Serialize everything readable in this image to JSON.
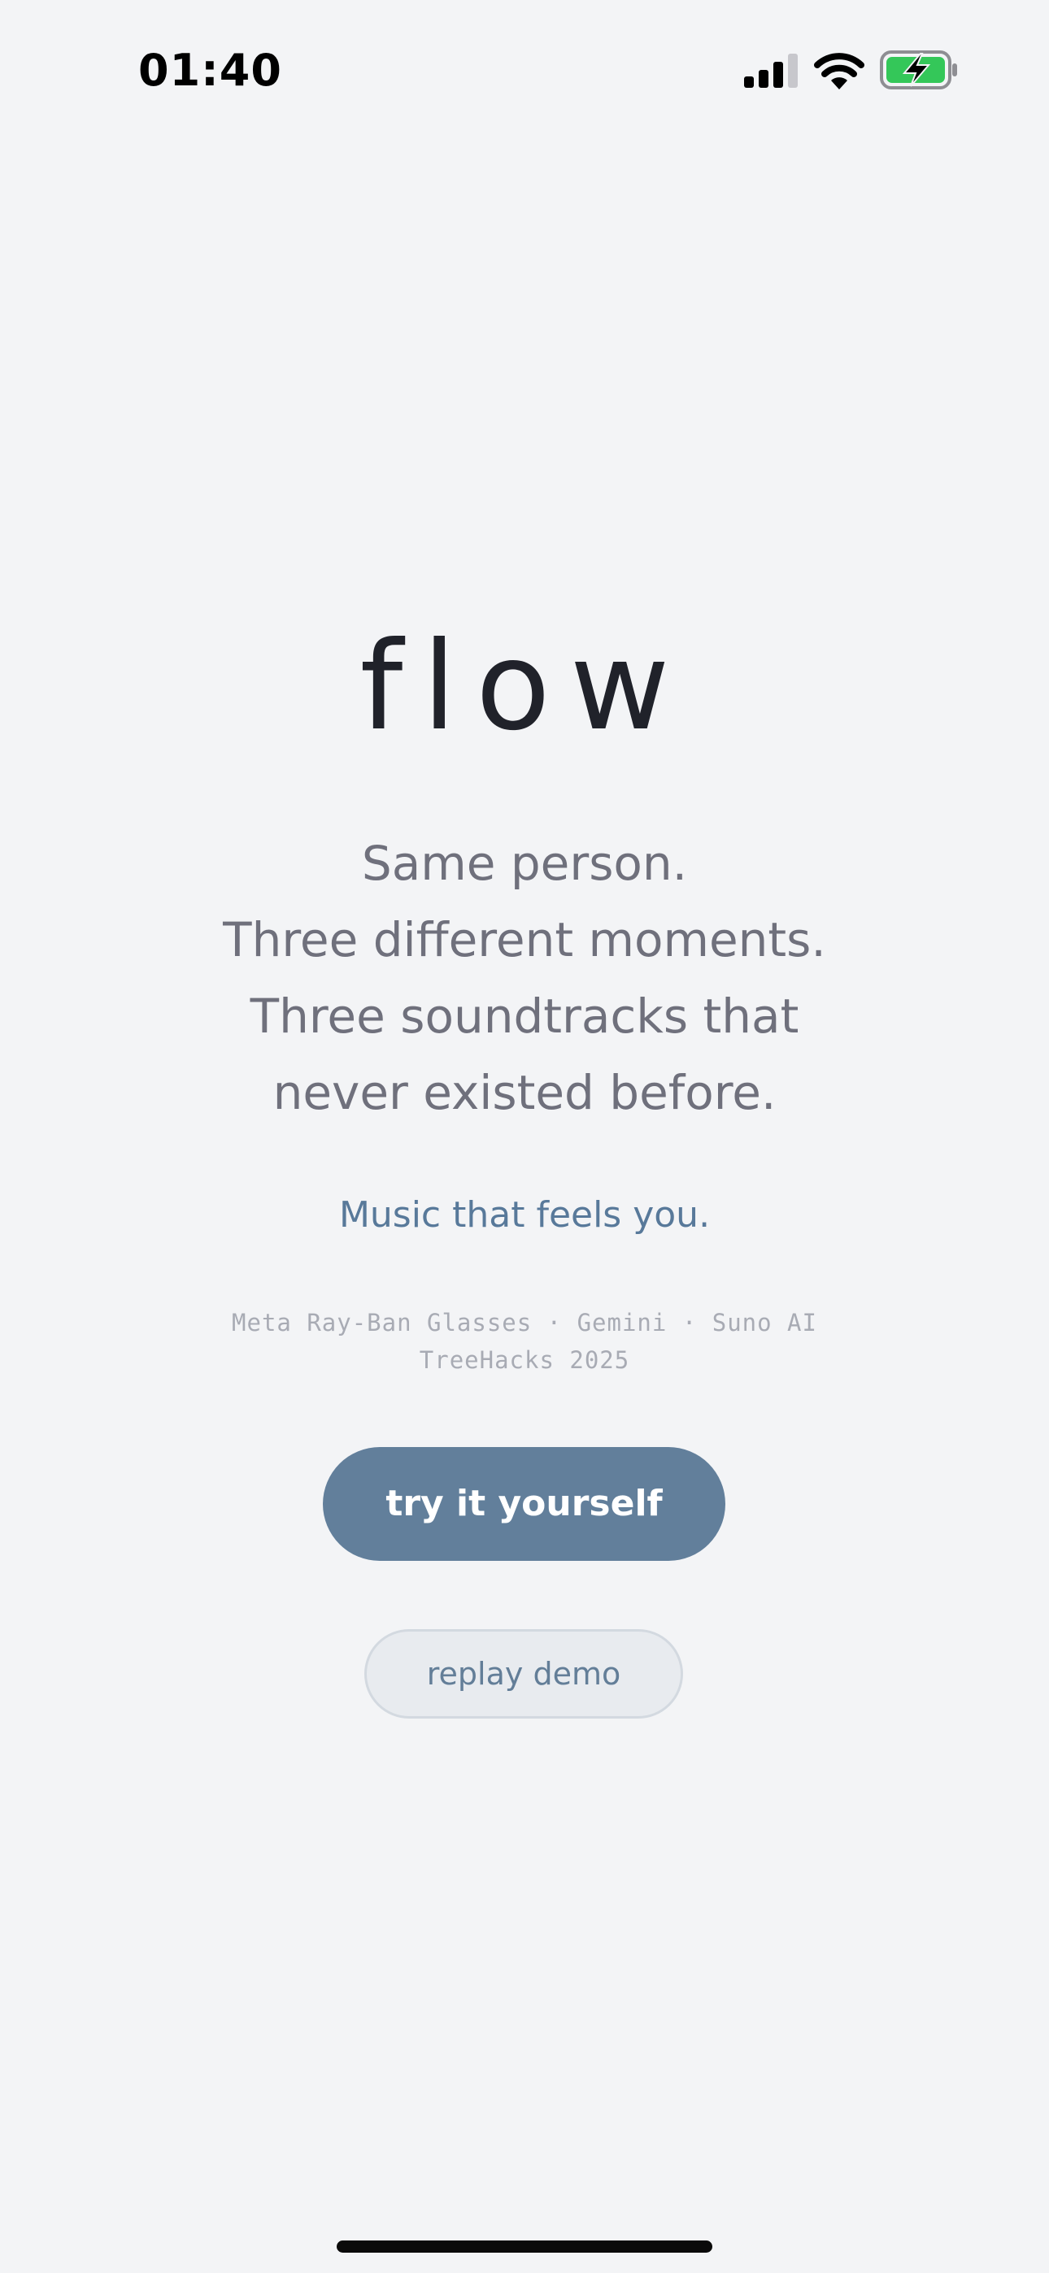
{
  "status_bar": {
    "time": "01:40",
    "icons": [
      "signal-icon",
      "wifi-icon",
      "battery-charging-icon"
    ],
    "battery_color": "#34c759"
  },
  "main": {
    "title": "flow",
    "tagline": [
      "Same person.",
      "Three different moments.",
      "Three soundtracks that",
      "never existed before."
    ],
    "subtitle": "Music that feels you.",
    "credits": {
      "line1": "Meta Ray-Ban Glasses · Gemini · Suno AI",
      "line2": "TreeHacks 2025"
    },
    "primary_button": "try it yourself",
    "secondary_button": "replay demo"
  },
  "colors": {
    "background": "#f3f4f6",
    "title": "#20222a",
    "tagline": "#6f707c",
    "accent": "#58799a",
    "primary_button_bg": "#627f9b",
    "secondary_button_bg": "#e8ebef"
  }
}
